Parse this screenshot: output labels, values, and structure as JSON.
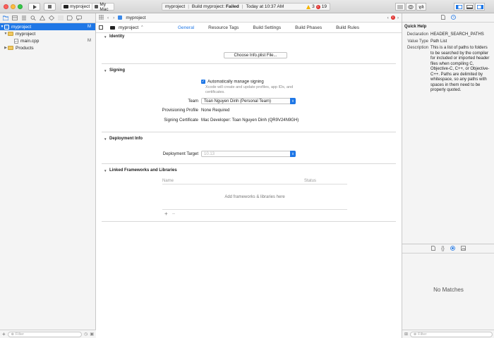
{
  "toolbar": {
    "scheme_project": "myproject",
    "scheme_destination": "My Mac",
    "activity_project": "myproject",
    "activity_build_prefix": "Build myproject:",
    "activity_build_status": "Failed",
    "activity_time": "Today at 10:37 AM",
    "warnings_count": "3",
    "errors_count": "19"
  },
  "navigator": {
    "items": [
      {
        "label": "myproject",
        "badge": "M"
      },
      {
        "label": "myproject",
        "badge": ""
      },
      {
        "label": "main.cpp",
        "badge": "M"
      },
      {
        "label": "Products",
        "badge": ""
      }
    ],
    "filter_placeholder": "Filter"
  },
  "editor": {
    "jumpbar_path": "myproject",
    "target_label": "myproject",
    "tabs": [
      "General",
      "Resource Tags",
      "Build Settings",
      "Build Phases",
      "Build Rules"
    ],
    "identity": {
      "title": "Identity",
      "choose_button": "Choose Info.plist File..."
    },
    "signing": {
      "title": "Signing",
      "auto_label": "Automatically manage signing",
      "auto_note_1": "Xcode will create and update profiles, app IDs, and",
      "auto_note_2": "certificates.",
      "team_label": "Team",
      "team_value": "Toan Nguyen Dinh (Personal Team)",
      "profile_label": "Provisioning Profile",
      "profile_value": "None Required",
      "cert_label": "Signing Certificate",
      "cert_value": "Mac Developer: Toan Nguyen Dinh (QR9V24N9GH)"
    },
    "deployment": {
      "title": "Deployment Info",
      "target_label": "Deployment Target",
      "target_value": "10.13"
    },
    "frameworks": {
      "title": "Linked Frameworks and Libraries",
      "col_name": "Name",
      "col_status": "Status",
      "empty_text": "Add frameworks & libraries here",
      "add": "+",
      "remove": "−"
    }
  },
  "inspector": {
    "quick_help_title": "Quick Help",
    "declaration_key": "Declaration",
    "declaration_value": "HEADER_SEARCH_PATHS",
    "value_type_key": "Value Type",
    "value_type_value": "Path List",
    "description_key": "Description",
    "description_value": "This is a list of paths to folders to be searched by the compiler for included or imported header files when compiling C, Objective-C, C++, or Objective-C++. Paths are delimited by whitespace, so any paths with spaces in them need to be properly quoted.",
    "no_matches": "No Matches",
    "filter_placeholder": "Filter"
  },
  "colors": {
    "accent": "#1f77e6",
    "failed": "#222222",
    "warning": "#f5b400",
    "error": "#e0312e"
  },
  "icons": [
    "play-icon",
    "stop-icon",
    "folder-icon",
    "file-icon",
    "chevron-left-icon",
    "chevron-right-icon",
    "grid-icon",
    "error-icon",
    "document-icon",
    "help-icon",
    "code-icon",
    "object-icon",
    "media-icon"
  ]
}
